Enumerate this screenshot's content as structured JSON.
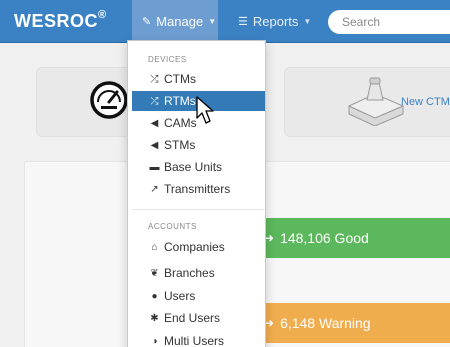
{
  "brand": {
    "name": "WESROC",
    "mark": "®"
  },
  "nav": {
    "manage": {
      "label": "Manage",
      "icon": "edit-icon"
    },
    "reports": {
      "label": "Reports",
      "icon": "list-icon"
    },
    "search": {
      "placeholder": "Search"
    }
  },
  "cards": {
    "right_label": "New CTM"
  },
  "dropdown": {
    "devices_header": "DEVICES",
    "devices": [
      {
        "label": "CTMs",
        "icon": "shuffle-icon"
      },
      {
        "label": "RTMs",
        "icon": "shuffle-icon"
      },
      {
        "label": "CAMs",
        "icon": "signal-icon"
      },
      {
        "label": "STMs",
        "icon": "signal-icon"
      },
      {
        "label": "Base Units",
        "icon": "hdd-icon"
      },
      {
        "label": "Transmitters",
        "icon": "share-icon"
      }
    ],
    "accounts_header": "ACCOUNTS",
    "accounts": [
      {
        "label": "Companies",
        "icon": "home-icon"
      },
      {
        "label": "Branches",
        "icon": "leaf-icon"
      },
      {
        "label": "Users",
        "icon": "user-icon"
      },
      {
        "label": "End Users",
        "icon": "asterisk-icon"
      },
      {
        "label": "Multi Users",
        "icon": "adjust-icon"
      }
    ]
  },
  "stats": {
    "good": {
      "text": "148,106 Good",
      "color": "#5cb85c"
    },
    "warning": {
      "text": "6,148 Warning",
      "color": "#f0ad4e"
    }
  },
  "colors": {
    "topbar": "#3b82c4",
    "active": "#337ab7"
  }
}
